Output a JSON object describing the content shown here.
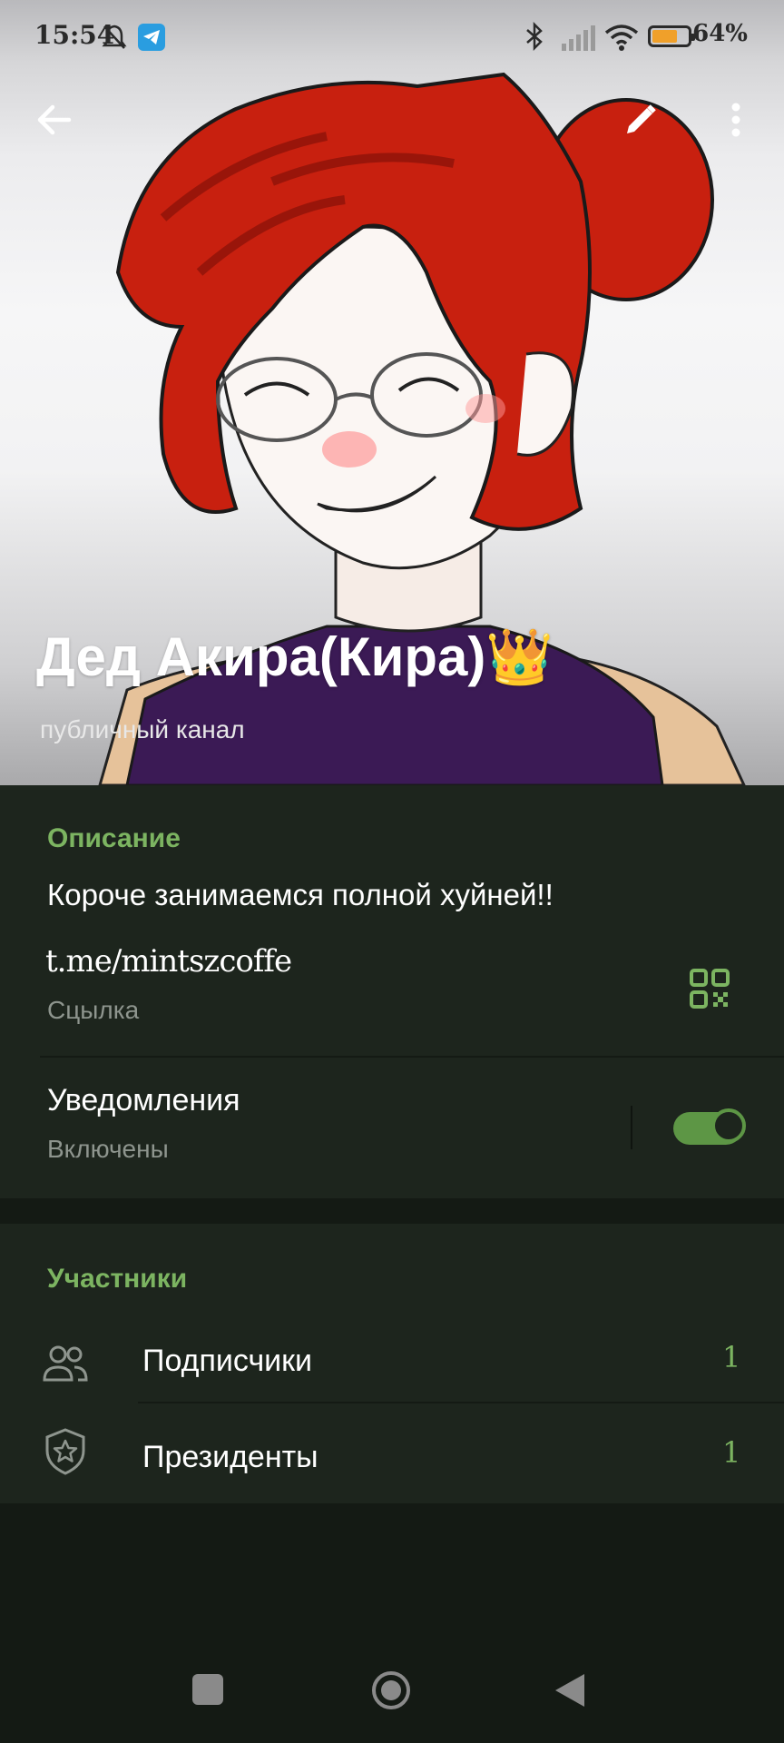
{
  "status_bar": {
    "time": "15:54",
    "battery": "64%"
  },
  "icons": {
    "back": "back-arrow-icon",
    "edit": "pencil-icon",
    "menu": "more-vertical-icon",
    "qr": "qr-code-icon",
    "subscribers": "people-icon",
    "presidents": "shield-star-icon"
  },
  "profile": {
    "title": "Дед Акира(Кира)👑",
    "subtitle": "публичный канал"
  },
  "info": {
    "description_label": "Описание",
    "description": "Короче занимаемся полной хуйней!!",
    "link": "t.me/mintszcoffe",
    "link_label": "Сцылка"
  },
  "notifications": {
    "title": "Уведомления",
    "status": "Включены",
    "enabled": true
  },
  "members": {
    "section_label": "Участники",
    "items": [
      {
        "label": "Подписчики",
        "count": "1"
      },
      {
        "label": "Президенты",
        "count": "1"
      }
    ]
  },
  "colors": {
    "accent": "#7cb461",
    "background": "#141a14",
    "card": "#1d251d",
    "hair": "#c8200f",
    "top": "#3b1a55"
  }
}
